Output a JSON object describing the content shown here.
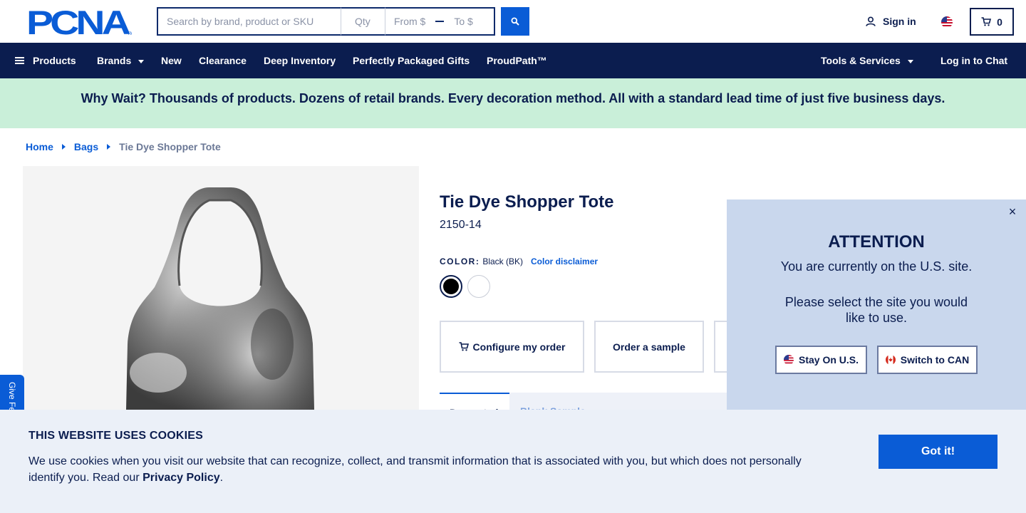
{
  "header": {
    "logo_text": "PCNA",
    "search_placeholder": "Search by brand, product or SKU",
    "qty_placeholder": "Qty",
    "from_placeholder": "From $",
    "to_placeholder": "To $",
    "search_icon": "search-icon",
    "signin_label": "Sign in",
    "locale_flag": "us-flag-icon",
    "cart_count": "0"
  },
  "nav": {
    "products": "Products",
    "brands": "Brands",
    "new": "New",
    "clearance": "Clearance",
    "deep_inventory": "Deep Inventory",
    "gifts": "Perfectly Packaged Gifts",
    "proudpath": "ProudPath™",
    "tools": "Tools & Services",
    "chat": "Log in to Chat"
  },
  "banner": {
    "text": "Why Wait? Thousands of products. Dozens of retail brands. Every decoration method. All with a standard lead time of just five business days."
  },
  "breadcrumb": {
    "home": "Home",
    "bags": "Bags",
    "current": "Tie Dye Shopper Tote"
  },
  "product": {
    "title": "Tie Dye Shopper Tote",
    "sku": "2150-14",
    "color_label": "COLOR:",
    "color_value": "Black (BK)",
    "color_disclaimer": "Color disclaimer",
    "swatches": [
      "Black",
      "White"
    ],
    "configure_label": "Configure my order",
    "sample_label": "Order a sample",
    "tab_active": "Decorated",
    "tab_second": "Blank Sample"
  },
  "feedback": {
    "label": "Give Feedback"
  },
  "modal": {
    "heading": "ATTENTION",
    "message1": "You are currently on the U.S. site.",
    "message2": "Please select the site you would like to use.",
    "stay_label": "Stay On U.S.",
    "switch_label": "Switch to CAN",
    "close_glyph": "×"
  },
  "cookie": {
    "title": "THIS WEBSITE USES COOKIES",
    "text": "We use cookies when you visit our website that can recognize, collect, and transmit information that is associated with you, but which does not personally identify you. Read our ",
    "policy_link": "Privacy Policy",
    "period": ".",
    "button": "Got it!"
  },
  "colors": {
    "navy": "#0b1d4f",
    "accent_blue": "#0a5cd6",
    "banner_green": "#c9efd9",
    "modal_bg": "#c9d7ed",
    "cookie_bg": "#ebf0f8"
  }
}
